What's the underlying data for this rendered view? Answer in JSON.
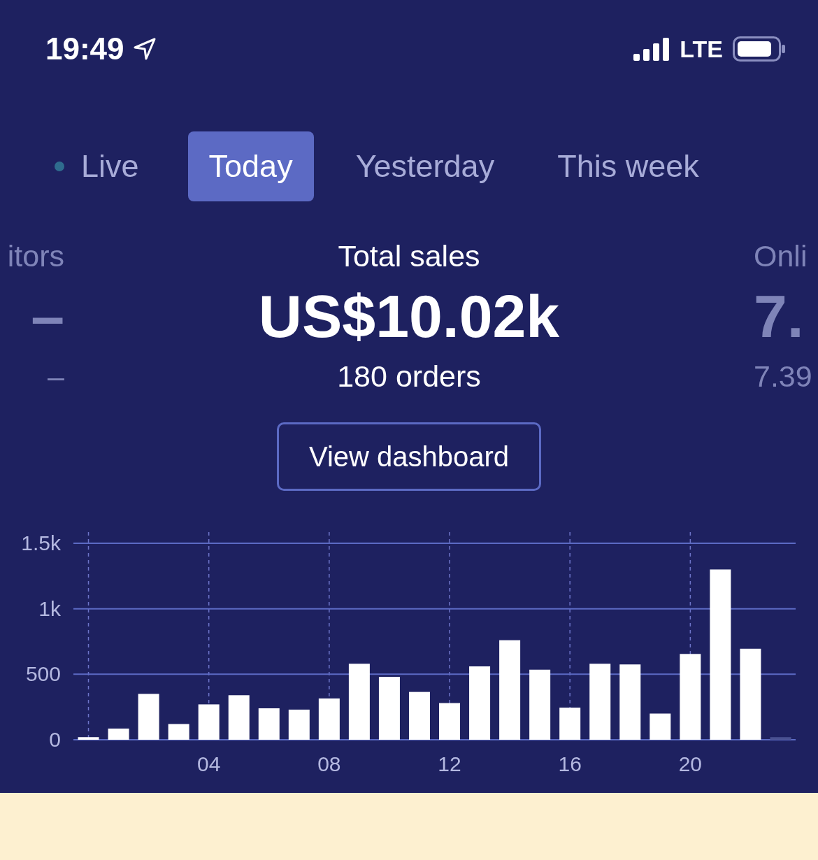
{
  "status_bar": {
    "time": "19:49",
    "network": "LTE"
  },
  "tabs": [
    {
      "label": "Live",
      "selected": false,
      "kind": "live"
    },
    {
      "label": "Today",
      "selected": true
    },
    {
      "label": "Yesterday",
      "selected": false
    },
    {
      "label": "This week",
      "selected": false
    }
  ],
  "stats": [
    {
      "label": "itors",
      "value": "–",
      "detail": "–"
    },
    {
      "label": "Total sales",
      "value": "US$10.02k",
      "detail": "180 orders"
    },
    {
      "label": "Onli",
      "value": "7.",
      "detail": "7.39"
    }
  ],
  "dashboard_button": "View dashboard",
  "chart_data": {
    "type": "bar",
    "x": [
      0,
      1,
      2,
      3,
      4,
      5,
      6,
      7,
      8,
      9,
      10,
      11,
      12,
      13,
      14,
      15,
      16,
      17,
      18,
      19,
      20,
      21,
      22,
      23
    ],
    "series": [
      {
        "color": "#ffffff",
        "values": [
          20,
          85,
          350,
          120,
          270,
          340,
          240,
          230,
          315,
          580,
          480,
          365,
          280,
          560,
          760,
          535,
          245,
          580,
          575,
          200,
          655,
          1300,
          695,
          null
        ]
      },
      {
        "color": "#4a5190",
        "values": [
          null,
          null,
          null,
          null,
          null,
          null,
          null,
          null,
          null,
          null,
          null,
          null,
          null,
          null,
          null,
          null,
          null,
          null,
          null,
          null,
          null,
          null,
          null,
          20
        ]
      }
    ],
    "xlim": [
      -0.5,
      23.5
    ],
    "ylim": [
      0,
      1500
    ],
    "yticks": [
      0,
      {
        "value": 500,
        "label": "500"
      },
      {
        "value": 1000,
        "label": "1k"
      },
      {
        "value": 1500,
        "label": "1.5k"
      }
    ],
    "xticks": [
      {
        "value": 4,
        "label": "04"
      },
      {
        "value": 8,
        "label": "08"
      },
      {
        "value": 12,
        "label": "12"
      },
      {
        "value": 16,
        "label": "16"
      },
      {
        "value": 20,
        "label": "20"
      }
    ],
    "grid": true
  }
}
